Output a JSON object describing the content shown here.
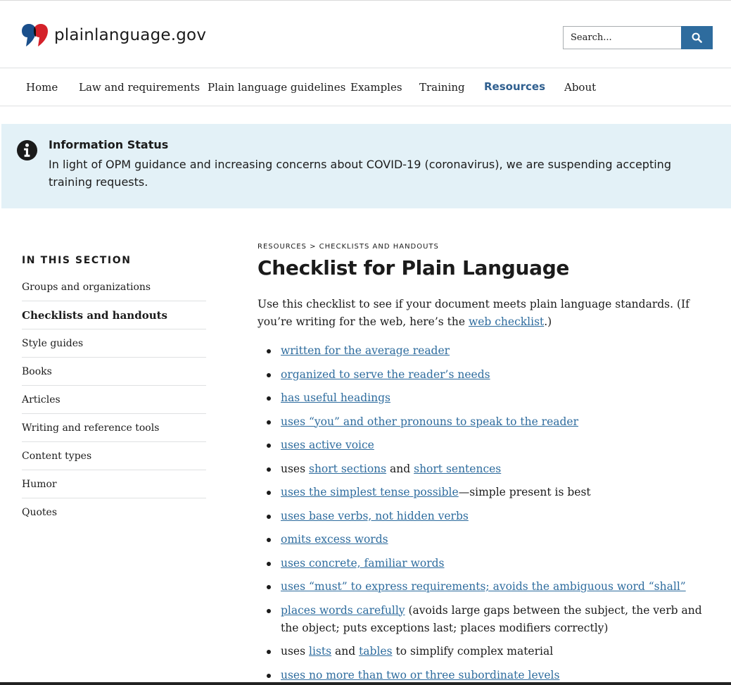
{
  "site": {
    "logo_text": "plainlanguage.gov",
    "brand_colors": {
      "blue": "#1a4f8b",
      "red": "#d4212a",
      "link": "#2e6c9e",
      "alert_bg": "#e3f1f7"
    }
  },
  "search": {
    "placeholder": "Search...",
    "icon": "search-icon"
  },
  "nav": {
    "items": [
      {
        "label": "Home"
      },
      {
        "label": "Law and requirements"
      },
      {
        "label": "Plain language guidelines"
      },
      {
        "label": "Examples"
      },
      {
        "label": "Training"
      },
      {
        "label": "Resources",
        "active": true
      },
      {
        "label": "About"
      }
    ]
  },
  "alert": {
    "icon": "info-icon",
    "title": "Information Status",
    "body": "In light of OPM guidance and increasing concerns about COVID-19 (coronavirus), we are suspending accepting training requests."
  },
  "sidebar": {
    "heading": "IN THIS SECTION",
    "items": [
      {
        "label": "Groups and organizations"
      },
      {
        "label": "Checklists and handouts",
        "current": true
      },
      {
        "label": "Style guides"
      },
      {
        "label": "Books"
      },
      {
        "label": "Articles"
      },
      {
        "label": "Writing and reference tools"
      },
      {
        "label": "Content types"
      },
      {
        "label": "Humor"
      },
      {
        "label": "Quotes"
      }
    ]
  },
  "main": {
    "breadcrumb": "RESOURCES > CHECKLISTS AND HANDOUTS",
    "title": "Checklist for Plain Language",
    "intro_before": "Use this checklist to see if your document meets plain language standards. (If you’re writing for the web, here’s the ",
    "intro_link": "web checklist",
    "intro_after": ".)",
    "checklist": [
      [
        {
          "link": "written for the average reader"
        }
      ],
      [
        {
          "link": "organized to serve the reader’s needs"
        }
      ],
      [
        {
          "link": "has useful headings"
        }
      ],
      [
        {
          "link": "uses “you” and other pronouns to speak to the reader"
        }
      ],
      [
        {
          "link": "uses active voice"
        }
      ],
      [
        {
          "text": "uses "
        },
        {
          "link": "short sections"
        },
        {
          "text": " and "
        },
        {
          "link": "short sentences"
        }
      ],
      [
        {
          "link": "uses the simplest tense possible"
        },
        {
          "text": "—simple present is best"
        }
      ],
      [
        {
          "link": "uses base verbs, not hidden verbs"
        }
      ],
      [
        {
          "link": "omits excess words"
        }
      ],
      [
        {
          "link": "uses concrete, familiar words"
        }
      ],
      [
        {
          "link": "uses “must” to express requirements; avoids the ambiguous word “shall”"
        }
      ],
      [
        {
          "link": "places words carefully"
        },
        {
          "text": " (avoids large gaps between the subject, the verb and the object; puts exceptions last; places modifiers correctly)"
        }
      ],
      [
        {
          "text": "uses "
        },
        {
          "link": "lists"
        },
        {
          "text": " and "
        },
        {
          "link": "tables"
        },
        {
          "text": " to simplify complex material"
        }
      ],
      [
        {
          "link": "uses no more than two or three subordinate levels"
        }
      ]
    ]
  }
}
